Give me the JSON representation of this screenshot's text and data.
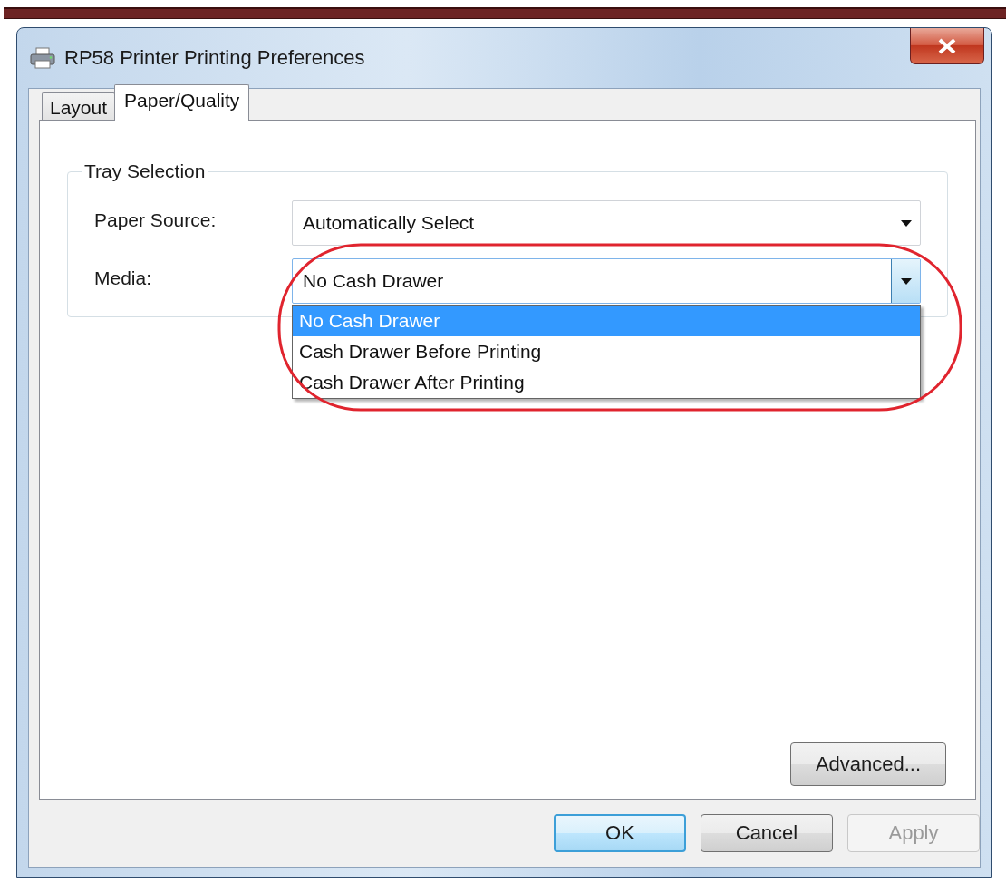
{
  "window": {
    "title": "RP58 Printer Printing Preferences"
  },
  "tabs": [
    {
      "label": "Layout",
      "selected": false
    },
    {
      "label": "Paper/Quality",
      "selected": true
    }
  ],
  "tray_selection": {
    "title": "Tray Selection",
    "fields": [
      {
        "label": "Paper Source:",
        "value": "Automatically Select",
        "expanded": false
      },
      {
        "label": "Media:",
        "value": "No Cash Drawer",
        "expanded": true,
        "options": [
          {
            "label": "No Cash Drawer",
            "selected": true
          },
          {
            "label": "Cash Drawer Before Printing",
            "selected": false
          },
          {
            "label": "Cash Drawer After Printing",
            "selected": false
          }
        ]
      }
    ]
  },
  "advanced_button": "Advanced...",
  "buttons": [
    {
      "label": "OK",
      "default": true,
      "disabled": false
    },
    {
      "label": "Cancel",
      "default": false,
      "disabled": false
    },
    {
      "label": "Apply",
      "default": false,
      "disabled": true
    }
  ]
}
